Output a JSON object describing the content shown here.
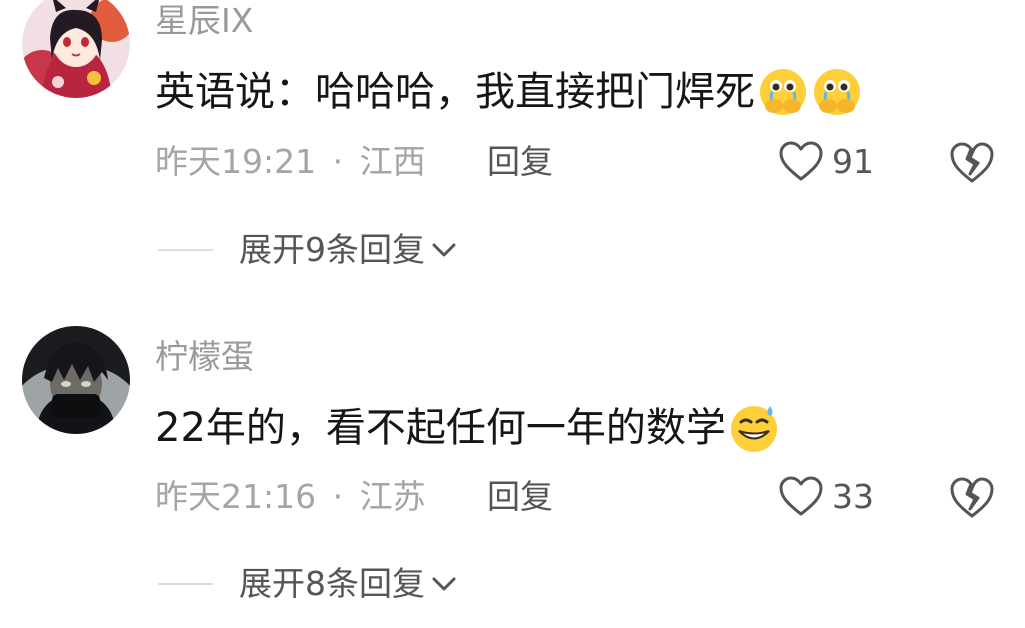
{
  "comments": [
    {
      "username": "星辰IX",
      "text": "英语说：哈哈哈，我直接把门焊死",
      "emoji_icons": [
        "crying-hands-emoji",
        "crying-hands-emoji"
      ],
      "time": "昨天19:21",
      "separator": "·",
      "location": "江西",
      "reply_label": "回复",
      "like_count": "91",
      "expand_label": "展开9条回复"
    },
    {
      "username": "柠檬蛋",
      "text": "22年的，看不起任何一年的数学",
      "emoji_icons": [
        "grin-sweat-emoji"
      ],
      "time": "昨天21:16",
      "separator": "·",
      "location": "江苏",
      "reply_label": "回复",
      "like_count": "33",
      "expand_label": "展开8条回复"
    }
  ],
  "colors": {
    "username": "#9a9a9a",
    "body_text": "#161616",
    "meta": "#a5a5a5",
    "action": "#555555",
    "divider": "#dddddd"
  }
}
